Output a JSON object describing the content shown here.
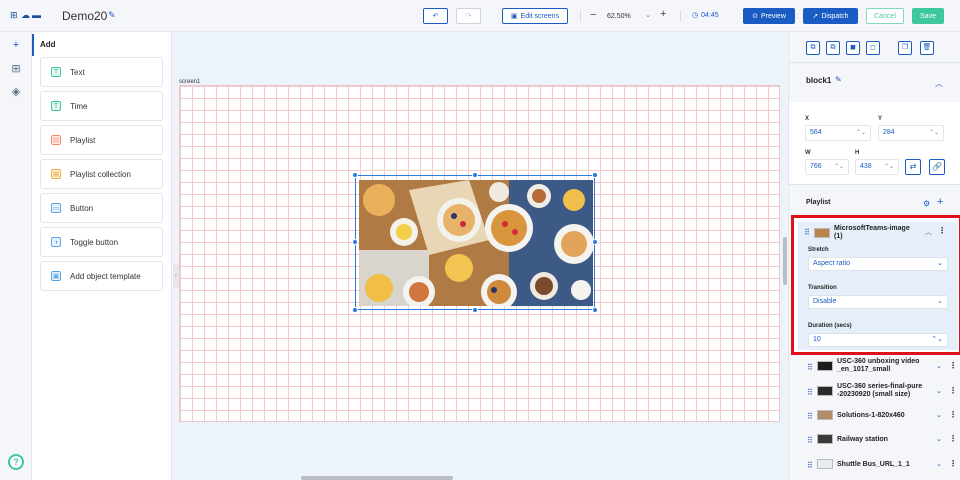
{
  "header": {
    "title": "Demo20",
    "edit_screens": "Edit screens",
    "zoom": "62.50%",
    "time": "04:45",
    "preview": "Preview",
    "dispatch": "Dispatch",
    "cancel": "Cancel",
    "save": "Save"
  },
  "add_panel": {
    "title": "Add",
    "items": [
      {
        "label": "Text",
        "icon": "text-icon",
        "color": "#3ec79e"
      },
      {
        "label": "Time",
        "icon": "time-icon",
        "color": "#3ec79e"
      },
      {
        "label": "Playlist",
        "icon": "playlist-icon",
        "color": "#f08a6c"
      },
      {
        "label": "Playlist collection",
        "icon": "playlist-collection-icon",
        "color": "#f0b040"
      },
      {
        "label": "Button",
        "icon": "button-icon",
        "color": "#5aa7e8"
      },
      {
        "label": "Toggle button",
        "icon": "toggle-icon",
        "color": "#5aa7e8"
      },
      {
        "label": "Add object template",
        "icon": "template-icon",
        "color": "#5aa7e8"
      }
    ]
  },
  "canvas": {
    "screen_label": "screen1"
  },
  "properties": {
    "block_name": "block1",
    "x_label": "X",
    "x": "564",
    "y_label": "Y",
    "y": "284",
    "w_label": "W",
    "w": "766",
    "h_label": "H",
    "h": "438"
  },
  "playlist": {
    "title": "Playlist",
    "selected": {
      "name": "MicrosoftTeams-image (1)",
      "stretch_label": "Stretch",
      "stretch": "Aspect ratio",
      "transition_label": "Transition",
      "transition": "Disable",
      "duration_label": "Duration (secs)",
      "duration": "10"
    },
    "items": [
      {
        "name": "USC-360 unboxing video _en_1017_small"
      },
      {
        "name": "USC-360 series-final-pure -20230920 (small size)"
      },
      {
        "name": "Solutions-1-820x460"
      },
      {
        "name": "Railway station"
      },
      {
        "name": "Shuttle Bus_URL_1_1"
      }
    ]
  },
  "colors": {
    "primary": "#1a5bc4",
    "success": "#3ec79e",
    "highlight": "#e0101a"
  }
}
